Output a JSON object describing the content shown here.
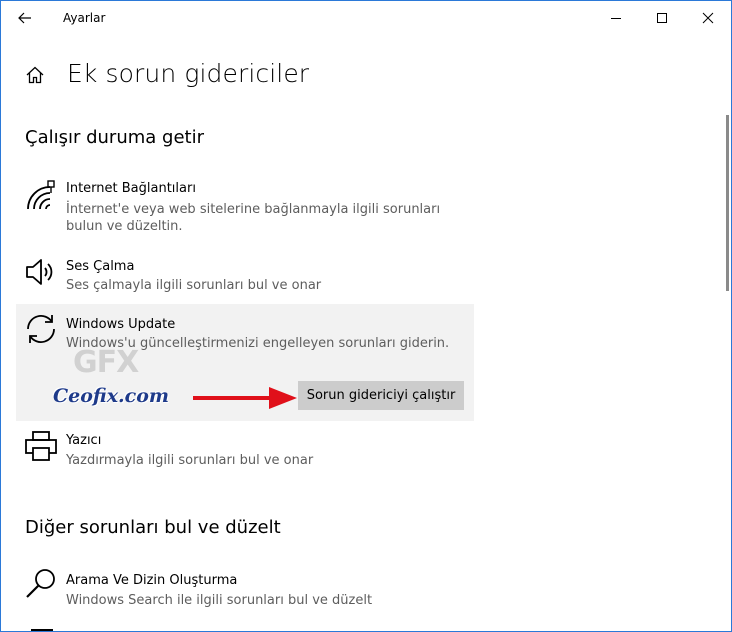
{
  "window": {
    "title": "Ayarlar",
    "border_color": "#2b79d8"
  },
  "page": {
    "title": "Ek sorun gidericiler"
  },
  "sections": {
    "get_running": {
      "title": "Çalışır duruma getir"
    },
    "other": {
      "title": "Diğer sorunları bul ve düzelt"
    }
  },
  "items": {
    "internet": {
      "name": "Internet Bağlantıları",
      "desc": "İnternet'e veya web sitelerine bağlanmayla ilgili sorunları bulun ve düzeltin.",
      "icon": "network-icon"
    },
    "audio": {
      "name": "Ses Çalma",
      "desc": "Ses çalmayla ilgili sorunları bul ve onar",
      "icon": "speaker-icon"
    },
    "windows_update": {
      "name": "Windows Update",
      "desc": "Windows'u güncelleştirmenizi engelleyen sorunları giderin.",
      "icon": "sync-icon",
      "button": "Sorun gidericiyi çalıştır"
    },
    "printer": {
      "name": "Yazıcı",
      "desc": "Yazdırmayla ilgili sorunları bul ve onar",
      "icon": "printer-icon"
    },
    "search": {
      "name": "Arama Ve Dizin Oluşturma",
      "desc": "Windows Search ile ilgili sorunları bul ve düzelt",
      "icon": "search-icon"
    }
  },
  "watermark": {
    "text": "Ceofix.com",
    "logo_text": "GFX"
  },
  "annotation": {
    "arrow_color": "#e0101a"
  }
}
